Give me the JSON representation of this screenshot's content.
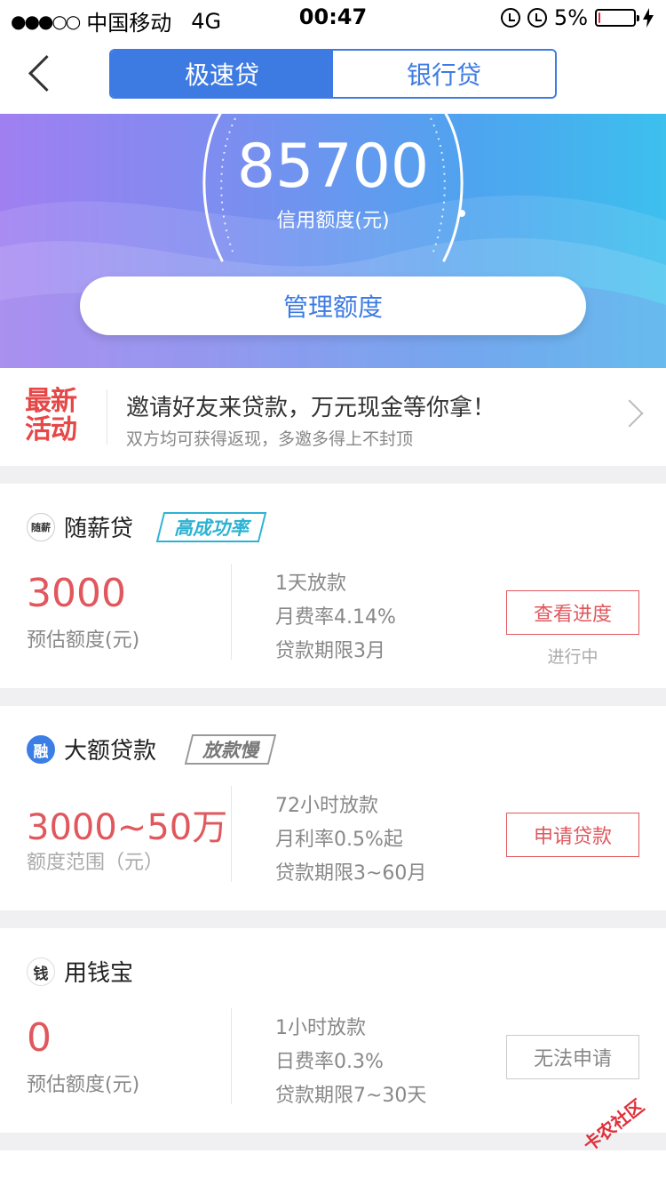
{
  "status": {
    "signal": "●●●○○",
    "carrier": "中国移动",
    "network": "4G",
    "time": "00:47",
    "battery": "5%",
    "battery_level": 0.05
  },
  "nav": {
    "tabs": [
      {
        "label": "极速贷",
        "active": true
      },
      {
        "label": "银行贷",
        "active": false
      }
    ]
  },
  "hero": {
    "amount": "85700",
    "amount_label": "信用额度(元)",
    "manage_label": "管理额度"
  },
  "promo": {
    "badge_line1": "最新",
    "badge_line2": "活动",
    "title": "邀请好友来贷款，万元现金等你拿！",
    "subtitle": "双方均可获得返现，多邀多得上不封顶"
  },
  "loans": [
    {
      "logo": "随薪",
      "name": "随薪贷",
      "tag": "高成功率",
      "amount": "3000",
      "amount_caption": "预估额度(元)",
      "details": [
        "1天放款",
        "月费率4.14%",
        "贷款期限3月"
      ],
      "action": "查看进度",
      "status": "进行中"
    },
    {
      "logo": "融",
      "name": "大额贷款",
      "tag": "放款慢",
      "amount": "3000~50万",
      "amount_caption": "额度范围（元）",
      "details": [
        "72小时放款",
        "月利率0.5%起",
        "贷款期限3~60月"
      ],
      "action": "申请贷款"
    },
    {
      "logo": "钱",
      "name": "用钱宝",
      "amount": "0",
      "amount_caption": "预估额度(元)",
      "details": [
        "1小时放款",
        "日费率0.3%",
        "贷款期限7~30天"
      ],
      "action": "无法申请"
    }
  ],
  "watermark": "卡农社区",
  "colors": {
    "primary": "#3d7be3",
    "accent_red": "#e0585e",
    "tag_teal": "#2cb2d2"
  }
}
